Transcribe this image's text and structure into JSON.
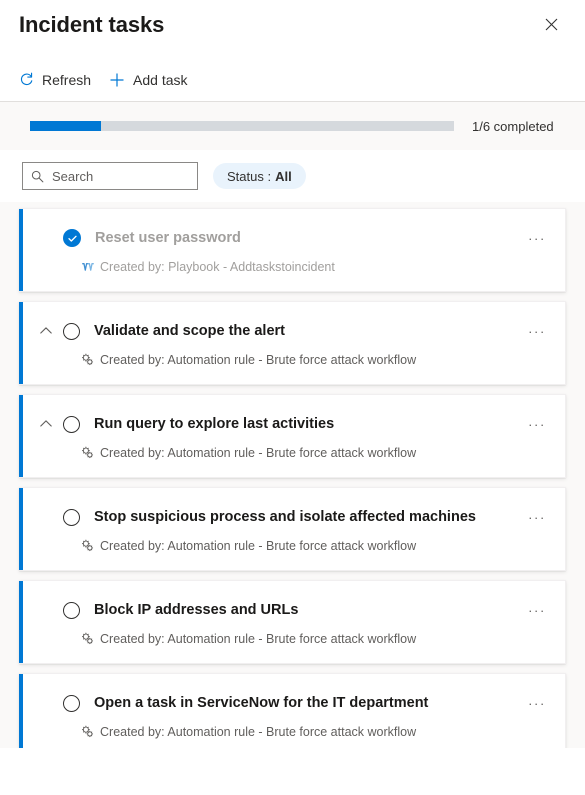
{
  "header": {
    "title": "Incident tasks",
    "close_icon": "close-icon"
  },
  "command_bar": {
    "refresh_label": "Refresh",
    "refresh_icon": "refresh-icon",
    "add_task_label": "Add task",
    "add_task_icon": "plus-icon"
  },
  "progress": {
    "completed": 1,
    "total": 6,
    "percent": 16.6667,
    "label": "1/6 completed",
    "fill_color": "#0078d4",
    "track_color": "#d5d9dd"
  },
  "filters": {
    "search_placeholder": "Search",
    "search_value": "",
    "search_icon": "search-icon",
    "status_label": "Status :",
    "status_value": "All",
    "status_pill_color": "#e9f3fc"
  },
  "tasks": [
    {
      "title": "Reset user password",
      "completed": true,
      "has_chevron": false,
      "source_icon": "playbook-icon",
      "source_text": "Created by: Playbook - Addtaskstoincident",
      "more_label": "···"
    },
    {
      "title": "Validate and scope the alert",
      "completed": false,
      "has_chevron": true,
      "source_icon": "automation-rule-icon",
      "source_text": "Created by: Automation rule - Brute force attack workflow",
      "more_label": "···"
    },
    {
      "title": "Run query to explore last activities",
      "completed": false,
      "has_chevron": true,
      "source_icon": "automation-rule-icon",
      "source_text": "Created by: Automation rule - Brute force attack workflow",
      "more_label": "···"
    },
    {
      "title": "Stop suspicious process and isolate affected machines",
      "completed": false,
      "has_chevron": false,
      "source_icon": "automation-rule-icon",
      "source_text": "Created by: Automation rule - Brute force attack workflow",
      "more_label": "···"
    },
    {
      "title": "Block IP addresses and URLs",
      "completed": false,
      "has_chevron": false,
      "source_icon": "automation-rule-icon",
      "source_text": "Created by: Automation rule - Brute force attack workflow",
      "more_label": "···"
    },
    {
      "title": "Open a task in ServiceNow for the IT department",
      "completed": false,
      "has_chevron": false,
      "source_icon": "automation-rule-icon",
      "source_text": "Created by: Automation rule - Brute force attack workflow",
      "more_label": "···"
    }
  ],
  "colors": {
    "accent": "#0078d4",
    "panel_bg": "#faf9f8",
    "card_bg": "#ffffff"
  }
}
